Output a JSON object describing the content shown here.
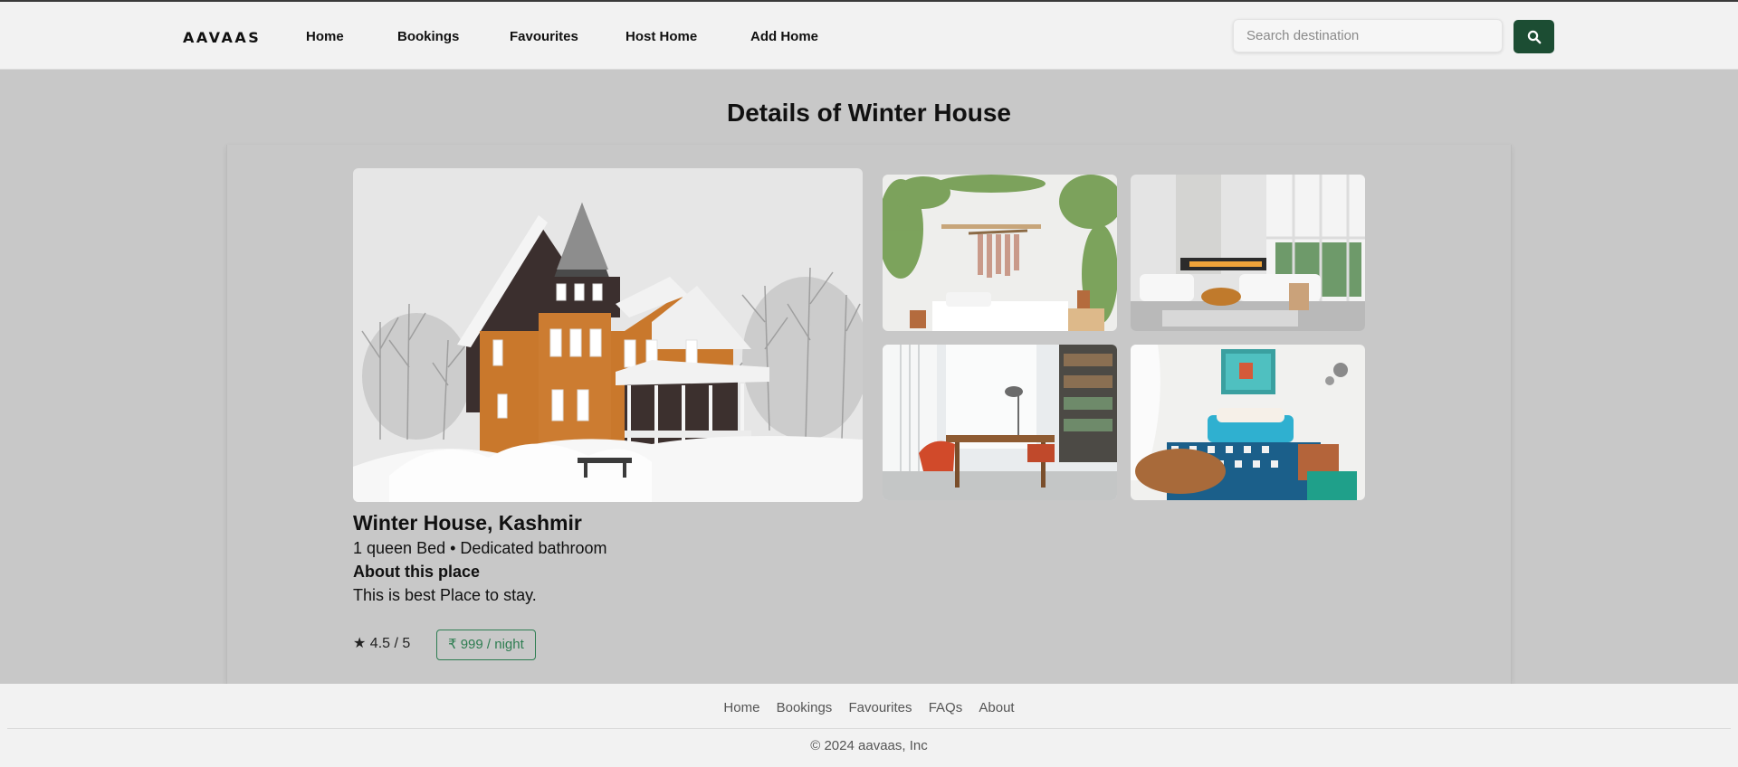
{
  "brand": "AAVAAS",
  "nav": {
    "items": [
      "Home",
      "Bookings",
      "Favourites",
      "Host Home",
      "Add Home"
    ]
  },
  "search": {
    "placeholder": "Search destination",
    "button_icon": "search-icon"
  },
  "page": {
    "title": "Details of Winter House"
  },
  "listing": {
    "name": "Winter House, Kashmir",
    "features": "1 queen Bed • Dedicated bathroom",
    "about_heading": "About this place",
    "about_text": "This is best Place to stay.",
    "rating": "★ 4.5 / 5",
    "price": "₹ 999 / night"
  },
  "footer": {
    "links": [
      "Home",
      "Bookings",
      "Favourites",
      "FAQs",
      "About"
    ],
    "copyright": "© 2024 aavaas, Inc"
  },
  "colors": {
    "accent": "#1c4d33",
    "price": "#2e7d51",
    "background": "#c8c8c8",
    "navbar": "#f2f2f2"
  }
}
